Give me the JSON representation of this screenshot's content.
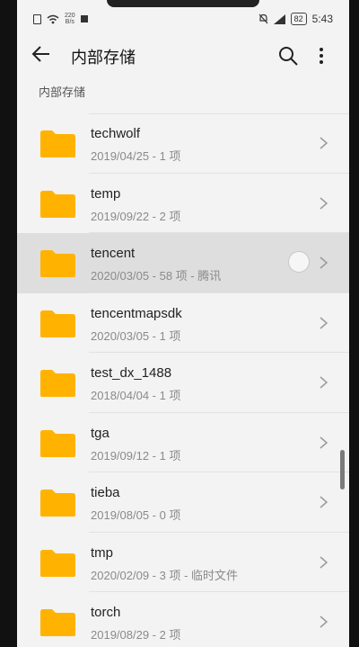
{
  "status_bar": {
    "speed_value": "220",
    "speed_unit": "B/s",
    "battery": "82",
    "time": "5:43"
  },
  "header": {
    "title": "内部存储",
    "back_icon": "arrow-left-icon",
    "search_icon": "search-icon",
    "more_icon": "more-vertical-icon"
  },
  "breadcrumb": "内部存储",
  "colors": {
    "folder": "#FFB300",
    "selected_row": "#DEDEDE",
    "background": "#F3F3F3"
  },
  "files": [
    {
      "name": "techwolf",
      "meta": "2019/04/25 - 1 项"
    },
    {
      "name": "temp",
      "meta": "2019/09/22 - 2 项"
    },
    {
      "name": "tencent",
      "meta": "2020/03/05 - 58 项 - 腾讯",
      "selected": true
    },
    {
      "name": "tencentmapsdk",
      "meta": "2020/03/05 - 1 项"
    },
    {
      "name": "test_dx_1488",
      "meta": "2018/04/04 - 1 项"
    },
    {
      "name": "tga",
      "meta": "2019/09/12 - 1 项"
    },
    {
      "name": "tieba",
      "meta": "2019/08/05 - 0 项"
    },
    {
      "name": "tmp",
      "meta": "2020/02/09 - 3 项 - 临时文件"
    },
    {
      "name": "torch",
      "meta": "2019/08/29 - 2 项"
    }
  ]
}
